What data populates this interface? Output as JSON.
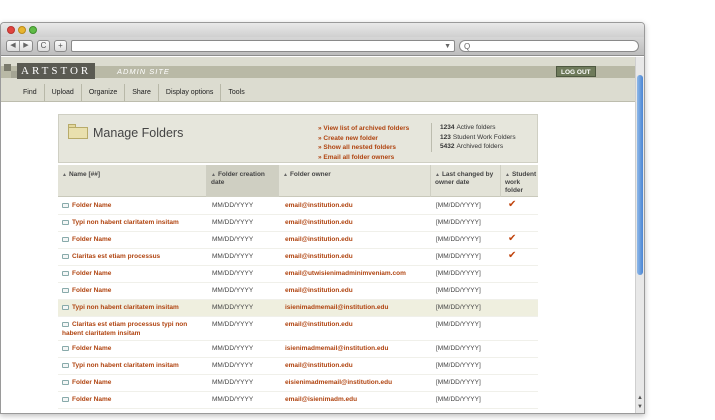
{
  "browser": {
    "back_glyph": "◀",
    "forward_glyph": "▶",
    "reload_glyph": "C",
    "add_glyph": "+",
    "url_value": "",
    "search_glyph": "Q"
  },
  "header": {
    "logo_text": "ARTSTOR",
    "subtitle": "ADMIN SITE",
    "logout_label": "LOG OUT",
    "menu": [
      "Find",
      "Upload",
      "Organize",
      "Share",
      "Display options",
      "Tools"
    ]
  },
  "panel": {
    "title": "Manage Folders",
    "actions": [
      "» View list of archived folders",
      "» Create new folder",
      "» Show all nested folders",
      "» Email all folder owners"
    ],
    "stats": [
      {
        "count": "1234",
        "label": "Active folders"
      },
      {
        "count": "123",
        "label": "Student Work Folders"
      },
      {
        "count": "5432",
        "label": "Archived folders"
      }
    ]
  },
  "table": {
    "columns": {
      "name": "Name [##]",
      "created": "Folder creation date",
      "owner": "Folder owner",
      "changed": "Last changed by owner date",
      "student": "Student work folder"
    },
    "rows": [
      {
        "name": "Folder Name",
        "created": "MM/DD/YYYY",
        "owner": "email@institution.edu",
        "changed": "[MM/DD/YYYY]",
        "check": "✔"
      },
      {
        "name": "Typi non habent claritatem insitam",
        "created": "MM/DD/YYYY",
        "owner": "email@institution.edu",
        "changed": "[MM/DD/YYYY]",
        "check": ""
      },
      {
        "name": "Folder Name",
        "created": "MM/DD/YYYY",
        "owner": "email@institution.edu",
        "changed": "[MM/DD/YYYY]",
        "check": "✔"
      },
      {
        "name": "Claritas est etiam processus",
        "created": "MM/DD/YYYY",
        "owner": "email@institution.edu",
        "changed": "[MM/DD/YYYY]",
        "check": "✔"
      },
      {
        "name": "Folder Name",
        "created": "MM/DD/YYYY",
        "owner": "email@utwisienimadminimveniam.com",
        "changed": "[MM/DD/YYYY]",
        "check": ""
      },
      {
        "name": "Folder Name",
        "created": "MM/DD/YYYY",
        "owner": "email@institution.edu",
        "changed": "[MM/DD/YYYY]",
        "check": ""
      },
      {
        "name": "Typi non habent claritatem insitam",
        "created": "MM/DD/YYYY",
        "owner": "isienimadmemail@institution.edu",
        "changed": "[MM/DD/YYYY]",
        "check": "",
        "highlight": true
      },
      {
        "name": "Claritas est etiam processus typi non habent claritatem insitam",
        "created": "MM/DD/YYYY",
        "owner": "email@institution.edu",
        "changed": "[MM/DD/YYYY]",
        "check": ""
      },
      {
        "name": "Folder Name",
        "created": "MM/DD/YYYY",
        "owner": "isienimadmemail@institution.edu",
        "changed": "[MM/DD/YYYY]",
        "check": ""
      },
      {
        "name": "Typi non habent claritatem insitam",
        "created": "MM/DD/YYYY",
        "owner": "email@institution.edu",
        "changed": "[MM/DD/YYYY]",
        "check": ""
      },
      {
        "name": "Folder Name",
        "created": "MM/DD/YYYY",
        "owner": "eisienimadmemail@institution.edu",
        "changed": "[MM/DD/YYYY]",
        "check": ""
      },
      {
        "name": "Folder Name",
        "created": "MM/DD/YYYY",
        "owner": "email@isienimadm.edu",
        "changed": "[MM/DD/YYYY]",
        "check": ""
      }
    ]
  },
  "colors": {
    "accent_link": "#b04410",
    "header_bg": "#dcdcd0",
    "brand_strip": "#b9b9a6",
    "logo_bg": "#5a5a52",
    "scroll_thumb": "#4a86d4"
  },
  "icons": [
    "back-icon",
    "forward-icon",
    "reload-icon",
    "add-tab-icon",
    "search-icon",
    "folder-icon",
    "checkmark-icon",
    "sort-arrow-icon"
  ]
}
